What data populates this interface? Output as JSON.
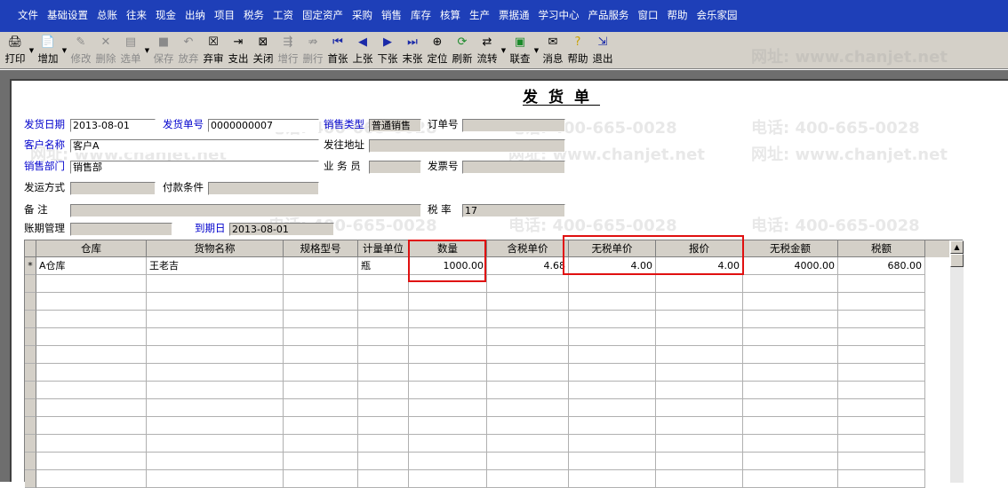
{
  "menu": [
    "文件",
    "基础设置",
    "总账",
    "往来",
    "现金",
    "出纳",
    "项目",
    "税务",
    "工资",
    "固定资产",
    "采购",
    "销售",
    "库存",
    "核算",
    "生产",
    "票据通",
    "学习中心",
    "产品服务",
    "窗口",
    "帮助",
    "会乐家园"
  ],
  "toolbar": {
    "print": "打印",
    "add": "增加",
    "modify": "修改",
    "delete": "删除",
    "select_order": "选单",
    "save": "保存",
    "abandon": "放弃",
    "unapprove": "弃审",
    "pay": "支出",
    "close": "关闭",
    "add_row": "增行",
    "delete_row": "删行",
    "first": "首张",
    "prev": "上张",
    "next": "下张",
    "last": "末张",
    "locate": "定位",
    "refresh": "刷新",
    "flow": "流转",
    "link": "联查",
    "message": "消息",
    "help": "帮助",
    "exit": "退出"
  },
  "title": "发货单",
  "form": {
    "ship_date_label": "发货日期",
    "ship_date": "2013-08-01",
    "ship_no_label": "发货单号",
    "ship_no": "0000000007",
    "sale_type_label": "销售类型",
    "sale_type": "普通销售",
    "order_no_label": "订单号",
    "order_no": "",
    "customer_label": "客户名称",
    "customer": "客户A",
    "ship_addr_label": "发往地址",
    "ship_addr": "",
    "dept_label": "销售部门",
    "dept": "销售部",
    "salesman_label": "业 务 员",
    "salesman": "",
    "invoice_no_label": "发票号",
    "invoice_no": "",
    "ship_method_label": "发运方式",
    "ship_method": "",
    "pay_terms_label": "付款条件",
    "pay_terms": "",
    "remark_label": "备    注",
    "remark": "",
    "tax_rate_label": "税    率",
    "tax_rate": "17",
    "period_label": "账期管理",
    "period": "",
    "due_date_label": "到期日",
    "due_date": "2013-08-01"
  },
  "table": {
    "headers": [
      "仓库",
      "货物名称",
      "规格型号",
      "计量单位",
      "数量",
      "含税单价",
      "无税单价",
      "报价",
      "无税金额",
      "税额"
    ],
    "rows": [
      {
        "marker": "*",
        "warehouse": "A仓库",
        "goods": "王老吉",
        "spec": "",
        "unit": "瓶",
        "qty": "1000.00",
        "tax_price": "4.68",
        "notax_price": "4.00",
        "quote": "4.00",
        "amount": "4000.00",
        "tax": "680.00"
      }
    ]
  },
  "watermark": {
    "phone": "电话: 400-665-0028",
    "site": "网址: www.chanjet.net"
  },
  "colors": {
    "menubar": "#1e3fb8",
    "highlight": "#e01010",
    "label_blue": "#0000cc",
    "field_gray": "#d4d0c8"
  }
}
